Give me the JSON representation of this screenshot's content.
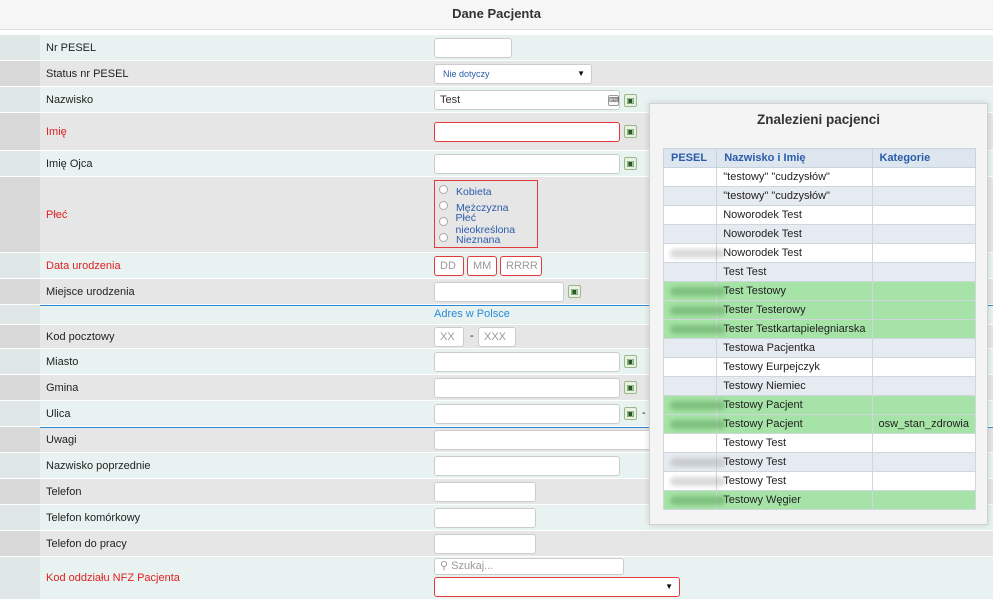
{
  "page": {
    "title": "Dane Pacjenta"
  },
  "form": {
    "pesel_label": "Nr PESEL",
    "pesel_status_label": "Status nr PESEL",
    "pesel_status_value": "Nie dotyczy",
    "nazwisko_label": "Nazwisko",
    "nazwisko_value": "Test",
    "imie_label": "Imię",
    "imie_ojca_label": "Imię Ojca",
    "plec_label": "Płeć",
    "plec_options": [
      "Kobieta",
      "Mężczyzna",
      "Płeć nieokreślona",
      "Nieznana"
    ],
    "data_urodzenia_label": "Data urodzenia",
    "date_placeholders": {
      "dd": "DD",
      "mm": "MM",
      "yyyy": "RRRR"
    },
    "miejsce_urodzenia_label": "Miejsce urodzenia",
    "adres_link": "Adres w Polsce",
    "kod_pocztowy_label": "Kod pocztowy",
    "kod_placeholders": {
      "a": "XX",
      "b": "XXX"
    },
    "miasto_label": "Miasto",
    "gmina_label": "Gmina",
    "ulica_label": "Ulica",
    "uwagi_label": "Uwagi",
    "nazwisko_poprzednie_label": "Nazwisko poprzednie",
    "telefon_label": "Telefon",
    "telefon_kom_label": "Telefon komórkowy",
    "telefon_praca_label": "Telefon do pracy",
    "nfz_label": "Kod oddziału NFZ Pacjenta",
    "nfz_search_placeholder": "Szukaj...",
    "dash": "-"
  },
  "popup": {
    "title": "Znalezieni pacjenci",
    "columns": [
      "PESEL",
      "Nazwisko i Imię",
      "Kategorie"
    ],
    "rows": [
      {
        "name": "\"testowy\" \"cudzysłów\"",
        "kategorie": ""
      },
      {
        "name": "\"testowy\" \"cudzysłów\"",
        "kategorie": ""
      },
      {
        "name": "Noworodek Test",
        "kategorie": ""
      },
      {
        "name": "Noworodek Test",
        "kategorie": ""
      },
      {
        "name": "Noworodek Test",
        "kategorie": ""
      },
      {
        "name": "Test Test",
        "kategorie": ""
      },
      {
        "name": "Test Testowy",
        "kategorie": ""
      },
      {
        "name": "Tester Testerowy",
        "kategorie": ""
      },
      {
        "name": "Tester Testkartapielegniarska",
        "kategorie": ""
      },
      {
        "name": "Testowa Pacjentka",
        "kategorie": ""
      },
      {
        "name": "Testowy Eurpejczyk",
        "kategorie": ""
      },
      {
        "name": "Testowy Niemiec",
        "kategorie": ""
      },
      {
        "name": "Testowy Pacjent",
        "kategorie": ""
      },
      {
        "name": "Testowy Pacjent",
        "kategorie": "osw_stan_zdrowia"
      },
      {
        "name": "Testowy Test",
        "kategorie": ""
      },
      {
        "name": "Testowy Test",
        "kategorie": ""
      },
      {
        "name": "Testowy Test",
        "kategorie": ""
      },
      {
        "name": "Testowy Węgier",
        "kategorie": ""
      }
    ]
  }
}
